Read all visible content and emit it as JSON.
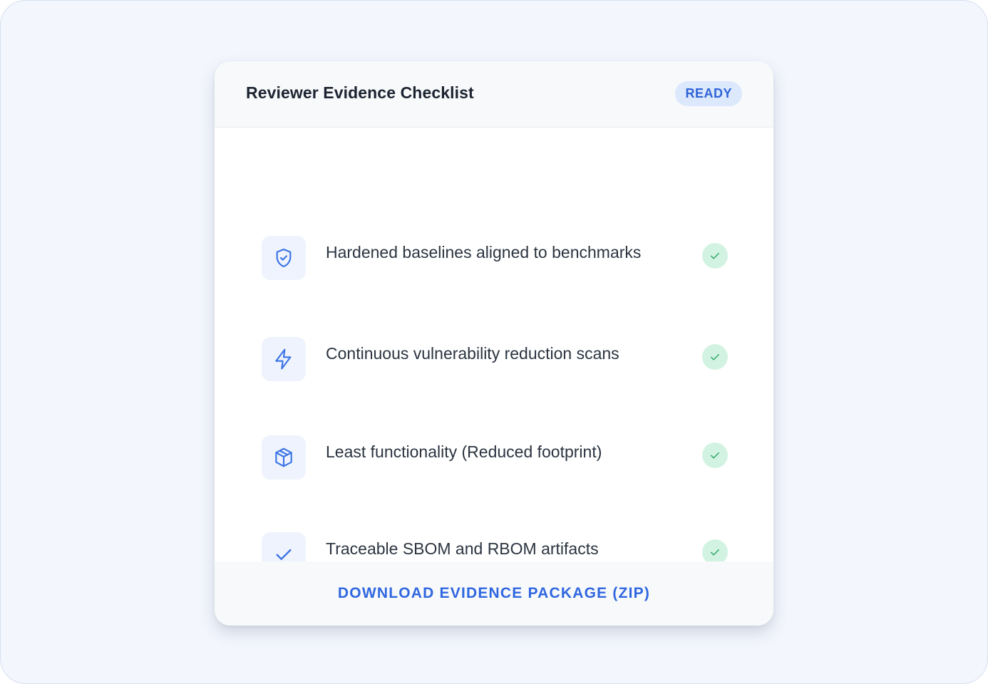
{
  "checklist": {
    "title": "Reviewer Evidence Checklist",
    "status": "READY",
    "items": [
      {
        "icon": "shield-check-icon",
        "label": "Hardened baselines aligned to benchmarks",
        "checked": true
      },
      {
        "icon": "lightning-bolt-icon",
        "label": "Continuous vulnerability reduction scans",
        "checked": true
      },
      {
        "icon": "package-box-icon",
        "label": "Least functionality (Reduced footprint)",
        "checked": true
      },
      {
        "icon": "checkmark-icon",
        "label": "Traceable SBOM and RBOM artifacts",
        "checked": true
      }
    ],
    "download_label": "DOWNLOAD EVIDENCE PACKAGE (ZIP)"
  },
  "colors": {
    "accent": "#2f67e0",
    "badge_bg": "#dce8fc",
    "success_bg": "#d3f3e2",
    "success": "#2fa86a",
    "background": "#f3f6fd"
  }
}
